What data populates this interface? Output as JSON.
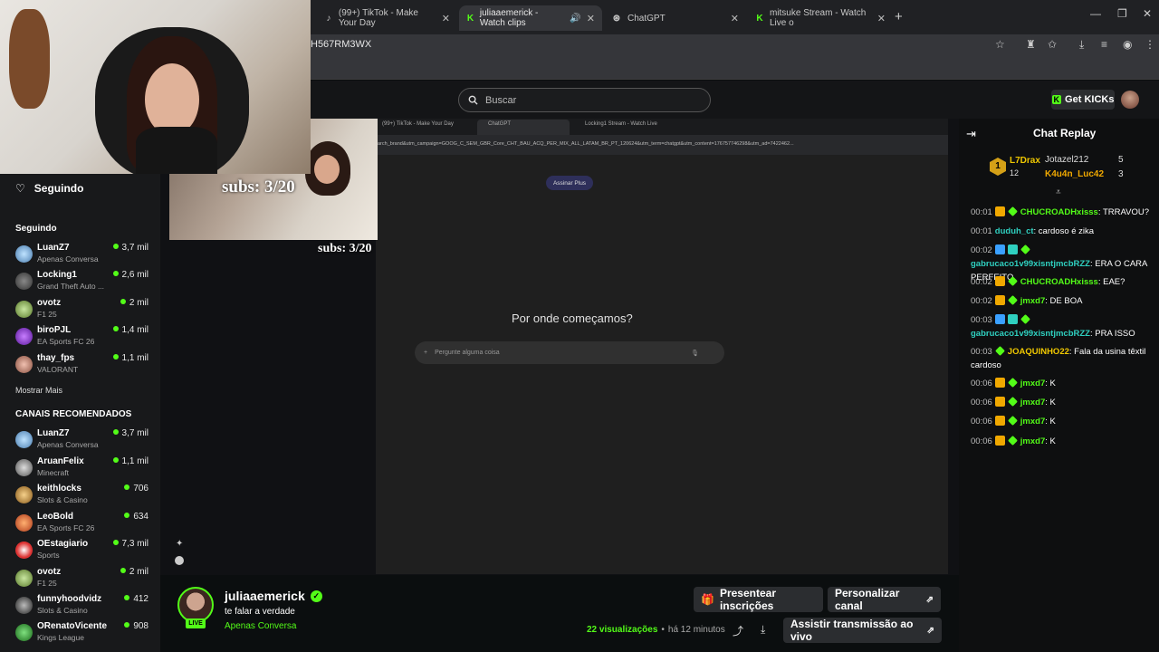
{
  "browser": {
    "tabs": [
      {
        "label": "(99+) TikTok - Make Your Day",
        "icon": "tiktok-icon"
      },
      {
        "label": "juliaaemerick - Watch clips",
        "icon": "kick-icon"
      },
      {
        "label": "ChatGPT",
        "icon": "chatgpt-icon"
      },
      {
        "label": "mitsuke Stream - Watch Live o",
        "icon": "kick-icon"
      }
    ],
    "url": "H567RM3WX"
  },
  "header": {
    "search_placeholder": "Buscar",
    "get_kicks": "Get KICKs"
  },
  "sidebar": {
    "following_title": "Seguindo",
    "following_head": "Seguindo",
    "following": [
      {
        "name": "LuanZ7",
        "category": "Apenas Conversa",
        "viewers": "3,7 mil"
      },
      {
        "name": "Locking1",
        "category": "Grand Theft Auto ...",
        "viewers": "2,6 mil"
      },
      {
        "name": "ovotz",
        "category": "F1 25",
        "viewers": "2 mil"
      },
      {
        "name": "biroPJL",
        "category": "EA Sports FC 26",
        "viewers": "1,4 mil"
      },
      {
        "name": "thay_fps",
        "category": "VALORANT",
        "viewers": "1,1 mil"
      }
    ],
    "show_more": "Mostrar Mais",
    "recommended_head": "CANAIS RECOMENDADOS",
    "recommended": [
      {
        "name": "LuanZ7",
        "category": "Apenas Conversa",
        "viewers": "3,7 mil"
      },
      {
        "name": "AruanFelix",
        "category": "Minecraft",
        "viewers": "1,1 mil"
      },
      {
        "name": "keithlocks",
        "category": "Slots & Casino",
        "viewers": "706"
      },
      {
        "name": "LeoBold",
        "category": "EA Sports FC 26",
        "viewers": "634"
      },
      {
        "name": "OEstagiario",
        "category": "Sports",
        "viewers": "7,3 mil"
      },
      {
        "name": "ovotz",
        "category": "F1 25",
        "viewers": "2 mil"
      },
      {
        "name": "funnyhoodvidz",
        "category": "Slots & Casino",
        "viewers": "412"
      },
      {
        "name": "ORenatoVicente",
        "category": "Kings League",
        "viewers": "908"
      }
    ]
  },
  "player": {
    "subs_overlay": "subs: 3/20",
    "inner_tabs": [
      "(99+) TikTok - Make Your Day",
      "ChatGPT",
      "Locking1 Stream - Watch Live"
    ],
    "inner_url": "arch_brand&utm_campaign=GOOG_C_SEM_GBR_Core_CHT_BAU_ACQ_PER_MIX_ALL_LATAM_BR_PT_120624&utm_term=chatgpt&utm_content=176757746298&utm_ad=7422462...",
    "plus_button": "Assinar Plus",
    "question": "Por onde começamos?",
    "input_placeholder": "Pergunte alguma coisa"
  },
  "stream": {
    "name": "juliaaemerick",
    "title": "te falar a verdade",
    "category": "Apenas Conversa",
    "live": "LIVE",
    "views_count": "22 visualizações",
    "time_ago": "há 12 minutos",
    "btn_gift": "Presentear inscrições",
    "btn_customize": "Personalizar canal",
    "btn_watch": "Assistir transmissão ao vivo"
  },
  "chat": {
    "title": "Chat Replay",
    "leaderboard": [
      {
        "rank": "1",
        "name": "L7Drax",
        "count": "12"
      },
      {
        "name": "Jotazel212",
        "count": "5"
      },
      {
        "name": "K4u4n_Luc42",
        "count": "3"
      }
    ],
    "messages": [
      {
        "time": "00:01",
        "user": "CHUCROADHxisss",
        "text": ": TRRAVOU?",
        "color": "#53fc18",
        "badges": [
          "crown",
          "star"
        ]
      },
      {
        "time": "00:01",
        "user": "duduh_ct",
        "text": ": cardoso é zika",
        "color": "#2fd0c0",
        "badges": []
      },
      {
        "time": "00:02",
        "user": "gabrucaco1v99xisntjmcbRZZ",
        "text": ": ERA O CARA PERFEITO",
        "color": "#2fd0c0",
        "badges": [
          "blue",
          "cyan",
          "star"
        ]
      },
      {
        "time": "00:02",
        "user": "CHUCROADHxisss",
        "text": ": EAE?",
        "color": "#53fc18",
        "badges": [
          "crown",
          "star"
        ]
      },
      {
        "time": "00:02",
        "user": "jmxd7",
        "text": ": DE BOA",
        "color": "#53fc18",
        "badges": [
          "crown",
          "star"
        ]
      },
      {
        "time": "00:03",
        "user": "gabrucaco1v99xisntjmcbRZZ",
        "text": ": PRA ISSO",
        "color": "#2fd0c0",
        "badges": [
          "blue",
          "cyan",
          "star"
        ]
      },
      {
        "time": "00:03",
        "user": "JOAQUINHO22",
        "text": ": Fala da usina têxtil cardoso",
        "color": "#f0c800",
        "badges": [
          "star"
        ]
      },
      {
        "time": "00:06",
        "user": "jmxd7",
        "text": ": K",
        "color": "#53fc18",
        "badges": [
          "crown",
          "star"
        ]
      },
      {
        "time": "00:06",
        "user": "jmxd7",
        "text": ": K",
        "color": "#53fc18",
        "badges": [
          "crown",
          "star"
        ]
      },
      {
        "time": "00:06",
        "user": "jmxd7",
        "text": ": K",
        "color": "#53fc18",
        "badges": [
          "crown",
          "star"
        ]
      },
      {
        "time": "00:06",
        "user": "jmxd7",
        "text": ": K",
        "color": "#53fc18",
        "badges": [
          "crown",
          "star"
        ]
      }
    ]
  },
  "colors": {
    "accent": "#53fc18"
  }
}
